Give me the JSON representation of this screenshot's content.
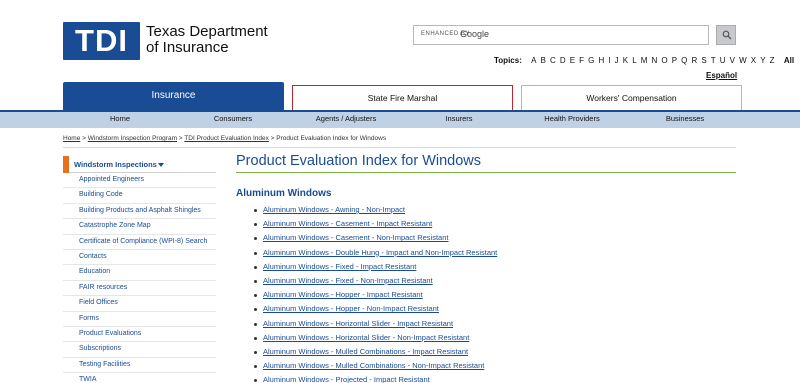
{
  "header": {
    "logo_mark": "TDI",
    "logo_line1": "Texas Department",
    "logo_line2": "of Insurance",
    "search_label": "ENHANCED BY",
    "search_brand": "Google",
    "topics_label": "Topics:",
    "letters": [
      "A",
      "B",
      "C",
      "D",
      "E",
      "F",
      "G",
      "H",
      "I",
      "J",
      "K",
      "L",
      "M",
      "N",
      "O",
      "P",
      "Q",
      "R",
      "S",
      "T",
      "U",
      "V",
      "W",
      "X",
      "Y",
      "Z"
    ],
    "all_label": "All",
    "espanol_label": "Español"
  },
  "tabs": {
    "insurance": "Insurance",
    "fire_marshal": "State Fire Marshal",
    "workers_comp": "Workers' Compensation",
    "colors": {
      "insurance": "#1a4c95",
      "fire_marshal": "#c0272d",
      "workers_comp": "#f2b22d"
    }
  },
  "nav": {
    "items": [
      "Home",
      "Consumers",
      "Agents / Adjusters",
      "Insurers",
      "Health Providers",
      "Businesses"
    ]
  },
  "breadcrumb": {
    "home": "Home",
    "sep1": " > ",
    "windstorm": "Windstorm Inspection Program",
    "sep2": " > ",
    "tdi_index": "TDI Product Evaluation Index",
    "sep3": " > ",
    "current": "Product Evaluation Index for Windows"
  },
  "sidebar": {
    "heading": "Windstorm Inspections",
    "items": [
      "Appointed Engineers",
      "Building Code",
      "Building Products and Asphalt Shingles",
      "Catastrophe Zone Map",
      "Certificate of Compliance (WPI-8) Search",
      "Contacts",
      "Education",
      "FAIR resources",
      "Field Offices",
      "Forms",
      "Product Evaluations",
      "Subscriptions",
      "Testing Facilities",
      "TWIA"
    ]
  },
  "main": {
    "title": "Product Evaluation Index for Windows",
    "section_title": "Aluminum Windows",
    "links": [
      "Aluminum Windows - Awning - Non-Impact",
      "Aluminum Windows - Casement - Impact Resistant",
      "Aluminum Windows - Casement - Non-Impact Resistant",
      "Aluminum Windows - Double Hung - Impact and Non-Impact Resistant",
      "Aluminum Windows - Fixed - Impact Resistant",
      "Aluminum Windows - Fixed - Non-Impact Resistant",
      "Aluminum Windows - Hopper - Impact Resistant",
      "Aluminum Windows - Hopper - Non-Impact Resistant",
      "Aluminum Windows - Horizontal Slider - Impact Resistant",
      "Aluminum Windows - Horizontal Slider - Non-Impact Resistant",
      "Aluminum Windows - Mulled Combinations - Impact Resistant",
      "Aluminum Windows - Mulled Combinations - Non-Impact Resistant",
      "Aluminum Windows - Projected - Impact Resistant"
    ]
  },
  "colors": {
    "brand_blue": "#1a4c95",
    "accent_orange": "#e8711e",
    "accent_green": "#7ab648",
    "nav_bg": "#bfd1e5"
  }
}
